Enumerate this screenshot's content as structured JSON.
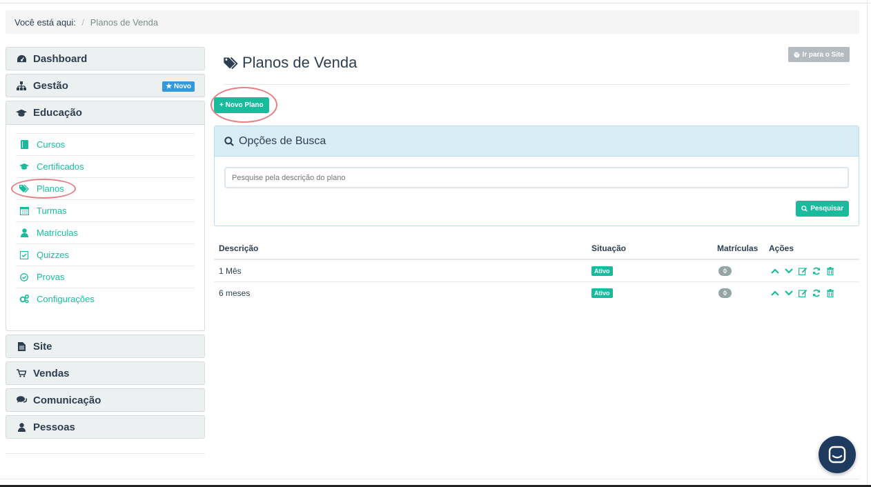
{
  "breadcrumb": {
    "label": "Você está aqui:",
    "separator": "/",
    "current": "Planos de Venda"
  },
  "sidebar": {
    "dashboard": "Dashboard",
    "gestao": "Gestão",
    "gestao_badge": "★ Novo",
    "educacao": "Educação",
    "edu_items": [
      "Cursos",
      "Certificados",
      "Planos",
      "Turmas",
      "Matrículas",
      "Quizzes",
      "Provas",
      "Configurações"
    ],
    "site": "Site",
    "vendas": "Vendas",
    "comunicacao": "Comunicação",
    "pessoas": "Pessoas"
  },
  "page": {
    "title": "Planos de Venda",
    "site_button": "Ir para o Site",
    "new_button": "+ Novo Plano"
  },
  "search": {
    "title": "Opções de Busca",
    "placeholder": "Pesquise pela descrição do plano",
    "button": "Pesquisar"
  },
  "table": {
    "headers": {
      "descricao": "Descrição",
      "situacao": "Situação",
      "matriculas": "Matrículas",
      "acoes": "Ações"
    },
    "rows": [
      {
        "descricao": "1 Mês",
        "situacao": "Ativo",
        "matriculas": "0"
      },
      {
        "descricao": "6 meses",
        "situacao": "Ativo",
        "matriculas": "0"
      }
    ]
  },
  "colors": {
    "accent": "#18bc9c",
    "dark": "#2c3e50",
    "info_bg": "#d9edf7",
    "highlight": "#e77f83",
    "badge_blue": "#3498db"
  },
  "icons": [
    "dashboard-icon",
    "sitemap-icon",
    "graduation-cap-icon",
    "book-icon",
    "tags-icon",
    "calendar-icon",
    "user-icon",
    "check-square-icon",
    "check-circle-icon",
    "cogs-icon",
    "file-icon",
    "cart-icon",
    "comments-icon",
    "globe-icon",
    "search-icon",
    "chevron-up-icon",
    "chevron-down-icon",
    "edit-icon",
    "refresh-icon",
    "trash-icon",
    "chat-icon"
  ]
}
